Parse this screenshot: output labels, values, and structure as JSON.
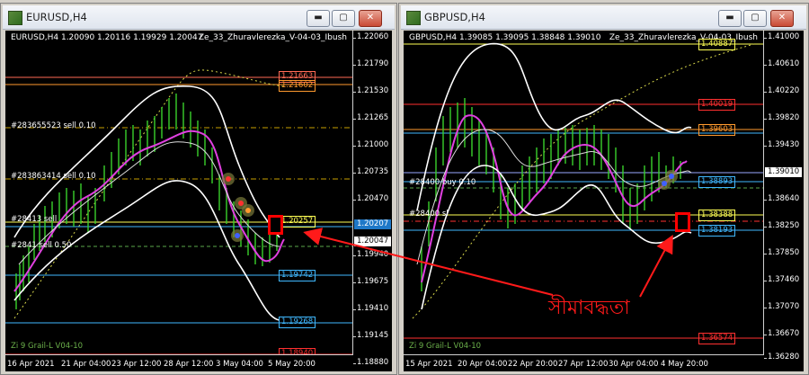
{
  "left": {
    "title": "EURUSD,H4",
    "info": "EURUSD,H4  1.20090 1.20116 1.19929 1.20047",
    "indicator": "Ze_33_Zhuravlerezka_V-04-03_Ibush",
    "bottom_indicator": "Zi 9 Grail-L V04-10",
    "y_ticks": [
      "1.22060",
      "1.21790",
      "1.21530",
      "1.21265",
      "1.21000",
      "1.20735",
      "1.20470",
      "1.20205",
      "1.19940",
      "1.19675",
      "1.19410",
      "1.19145",
      "1.18880"
    ],
    "x_ticks": [
      "16 Apr 2021",
      "21 Apr 04:00",
      "23 Apr 12:00",
      "28 Apr 12:00",
      "3 May 04:00",
      "5 May 20:00"
    ],
    "price_labels": [
      {
        "text": "1.21663",
        "color": "#ff6a55"
      },
      {
        "text": "1.21602",
        "color": "#ff9a2e"
      },
      {
        "text": "1.20257",
        "color": "#ffff55"
      },
      {
        "text": "1.20207",
        "color": "#40b8ff"
      },
      {
        "text": "1.20047",
        "color": "#ffffff"
      },
      {
        "text": "1.19742",
        "color": "#40b8ff"
      },
      {
        "text": "1.19268",
        "color": "#40b8ff"
      },
      {
        "text": "1.18940",
        "color": "#ff3030"
      }
    ],
    "level_labels": [
      "#283655523 sell 0.10",
      "#283863414 sell 0.10",
      "#28413 sell",
      "#2841 sell 0.50"
    ]
  },
  "right": {
    "title": "GBPUSD,H4",
    "info": "GBPUSD,H4  1.39085 1.39095 1.38848 1.39010",
    "indicator": "Ze_33_Zhuravlerezka_V-04-03_Ibush",
    "bottom_indicator": "Zi 9 Grail-L V04-10",
    "y_ticks": [
      "1.41000",
      "1.40610",
      "1.40220",
      "1.39820",
      "1.39430",
      "1.39010",
      "1.38640",
      "1.38250",
      "1.37850",
      "1.37460",
      "1.37070",
      "1.36670",
      "1.36280"
    ],
    "x_ticks": [
      "15 Apr 2021",
      "20 Apr 04:00",
      "22 Apr 20:00",
      "27 Apr 12:00",
      "30 Apr 04:00",
      "4 May 20:00"
    ],
    "price_labels": [
      {
        "text": "1.40887",
        "color": "#ffff55"
      },
      {
        "text": "1.40019",
        "color": "#ff3030"
      },
      {
        "text": "1.39603",
        "color": "#ff9a2e"
      },
      {
        "text": "1.39010",
        "color": "#ffffff"
      },
      {
        "text": "1.38893",
        "color": "#40b8ff"
      },
      {
        "text": "1.38388",
        "color": "#ffff55"
      },
      {
        "text": "1.38193",
        "color": "#40b8ff"
      },
      {
        "text": "1.36574",
        "color": "#ff3030"
      }
    ],
    "level_labels": [
      "#28400 buy 0.10",
      "#28400 sl"
    ]
  },
  "annotation": "সীমাবদ্ধতা",
  "window_controls": {
    "min": "▬",
    "max": "▢",
    "close": "✕"
  }
}
